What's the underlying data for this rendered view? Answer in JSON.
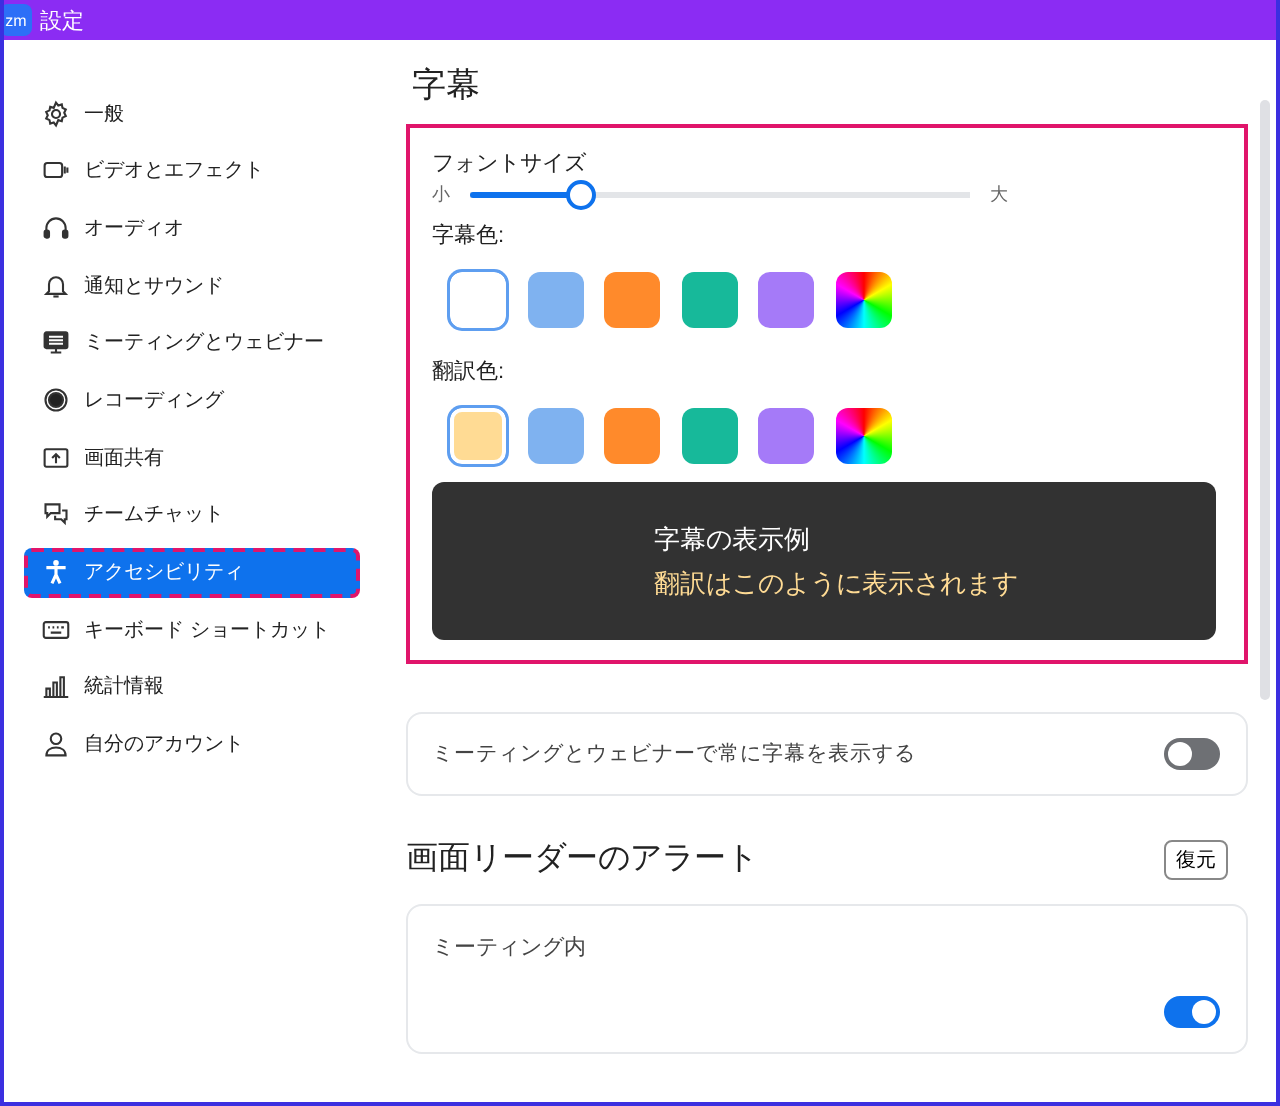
{
  "window": {
    "title": "設定",
    "logo": "zm"
  },
  "sidebar": {
    "items": [
      {
        "label": "一般",
        "selected": false
      },
      {
        "label": "ビデオとエフェクト",
        "selected": false
      },
      {
        "label": "オーディオ",
        "selected": false
      },
      {
        "label": "通知とサウンド",
        "selected": false
      },
      {
        "label": "ミーティングとウェビナー",
        "selected": false
      },
      {
        "label": "レコーディング",
        "selected": false
      },
      {
        "label": "画面共有",
        "selected": false
      },
      {
        "label": "チームチャット",
        "selected": false
      },
      {
        "label": "アクセシビリティ",
        "selected": true
      },
      {
        "label": "キーボード ショートカット",
        "selected": false
      },
      {
        "label": "統計情報",
        "selected": false
      },
      {
        "label": "自分のアカウント",
        "selected": false
      }
    ]
  },
  "content": {
    "title": "字幕",
    "caption_settings": {
      "font_size": {
        "label": "フォントサイズ",
        "min_label": "小",
        "max_label": "大",
        "level": 0.22
      },
      "caption_color": {
        "label": "字幕色:",
        "swatches": [
          {
            "kind": "solid",
            "color": "#ffffff",
            "selected": true
          },
          {
            "kind": "solid",
            "color": "#7fb2f0",
            "selected": false
          },
          {
            "kind": "solid",
            "color": "#ff8a2b",
            "selected": false
          },
          {
            "kind": "solid",
            "color": "#17b99a",
            "selected": false
          },
          {
            "kind": "solid",
            "color": "#a57af8",
            "selected": false
          },
          {
            "kind": "custom",
            "selected": false
          }
        ]
      },
      "translation_color": {
        "label": "翻訳色:",
        "swatches": [
          {
            "kind": "solid",
            "color": "#ffdb94",
            "selected": true
          },
          {
            "kind": "solid",
            "color": "#7fb2f0",
            "selected": false
          },
          {
            "kind": "solid",
            "color": "#ff8a2b",
            "selected": false
          },
          {
            "kind": "solid",
            "color": "#17b99a",
            "selected": false
          },
          {
            "kind": "solid",
            "color": "#a57af8",
            "selected": false
          },
          {
            "kind": "custom",
            "selected": false
          }
        ]
      },
      "preview": {
        "caption": "字幕の表示例",
        "translation": "翻訳はこのように表示されます"
      }
    },
    "always_show": {
      "label": "ミーティングとウェビナーで常に字幕を表示する",
      "on": false
    },
    "screen_reader": {
      "title": "画面リーダーのアラート",
      "restore_button": "復元",
      "group": {
        "title": "ミーティング内",
        "toggle_on": true
      }
    }
  }
}
